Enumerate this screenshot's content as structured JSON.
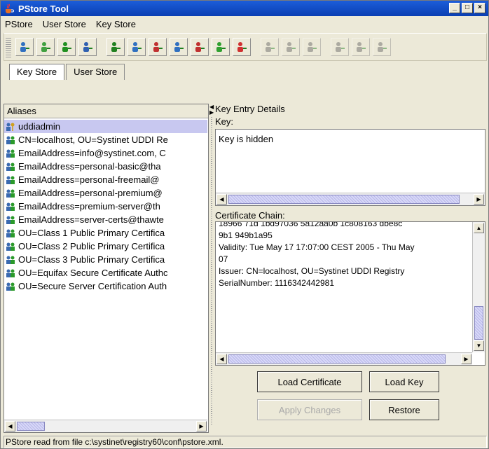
{
  "window": {
    "title": "PStore Tool",
    "controls": {
      "minimize": "_",
      "maximize": "□",
      "close": "×"
    }
  },
  "menu": [
    "PStore",
    "User Store",
    "Key Store"
  ],
  "toolbar": {
    "buttons": [
      {
        "icon": "users-list-icon",
        "enabled": true
      },
      {
        "icon": "users-group-icon",
        "enabled": true
      },
      {
        "icon": "user-key-icon",
        "enabled": true
      },
      {
        "icon": "window-icon",
        "enabled": true
      },
      {
        "icon": "add-user-icon",
        "enabled": true
      },
      {
        "icon": "user-card-icon",
        "enabled": true
      },
      {
        "icon": "document-edit-icon",
        "enabled": true
      },
      {
        "icon": "import-user-icon",
        "enabled": true
      },
      {
        "icon": "remove-user-icon",
        "enabled": true
      },
      {
        "icon": "user-cert-icon",
        "enabled": true
      },
      {
        "icon": "key-arrow-icon",
        "enabled": true
      },
      {
        "icon": "add-user-disabled-icon",
        "enabled": false
      },
      {
        "icon": "remove-user-disabled-icon",
        "enabled": false
      },
      {
        "icon": "user-cert-disabled-icon",
        "enabled": false
      },
      {
        "icon": "key-add-disabled-icon",
        "enabled": false
      },
      {
        "icon": "key-edit-disabled-icon",
        "enabled": false
      },
      {
        "icon": "key-cert-disabled-icon",
        "enabled": false
      }
    ]
  },
  "tabs": [
    {
      "label": "Key Store",
      "active": true
    },
    {
      "label": "User Store",
      "active": false
    }
  ],
  "aliases": {
    "header": "Aliases",
    "items": [
      {
        "label": "uddiadmin",
        "type": "key",
        "selected": true
      },
      {
        "label": "CN=localhost, OU=Systinet UDDI Re",
        "type": "cert"
      },
      {
        "label": "EmailAddress=info@systinet.com, C",
        "type": "cert"
      },
      {
        "label": "EmailAddress=personal-basic@tha",
        "type": "cert"
      },
      {
        "label": "EmailAddress=personal-freemail@",
        "type": "cert"
      },
      {
        "label": "EmailAddress=personal-premium@",
        "type": "cert"
      },
      {
        "label": "EmailAddress=premium-server@th",
        "type": "cert"
      },
      {
        "label": "EmailAddress=server-certs@thawte",
        "type": "cert"
      },
      {
        "label": "OU=Class 1 Public Primary Certifica",
        "type": "cert"
      },
      {
        "label": "OU=Class 2 Public Primary Certifica",
        "type": "cert"
      },
      {
        "label": "OU=Class 3 Public Primary Certifica",
        "type": "cert"
      },
      {
        "label": "OU=Equifax Secure Certificate Authc",
        "type": "cert"
      },
      {
        "label": "OU=Secure Server Certification Auth",
        "type": "cert"
      }
    ]
  },
  "details": {
    "title": "Key Entry Details",
    "key_label": "Key:",
    "key_text": "Key is hidden",
    "chain_label": "Certificate Chain:",
    "chain_lines": [
      "18966 71d 1bd97036 5a12aa0b 1c808163 dbe8c",
      "9b1 949b1a95",
      "Validity: Tue May 17 17:07:00 CEST 2005 - Thu May",
      "07",
      "Issuer: CN=localhost, OU=Systinet UDDI Registry",
      "SerialNumber: 1116342442981"
    ]
  },
  "buttons": {
    "load_certificate": "Load Certificate",
    "load_key": "Load Key",
    "apply_changes": "Apply Changes",
    "restore": "Restore"
  },
  "status": "PStore read from file c:\\systinet\\registry60\\conf\\pstore.xml.",
  "colors": {
    "title_bar": "#0a3fb3",
    "selection": "#c8c8f0",
    "face": "#ece9d8"
  }
}
